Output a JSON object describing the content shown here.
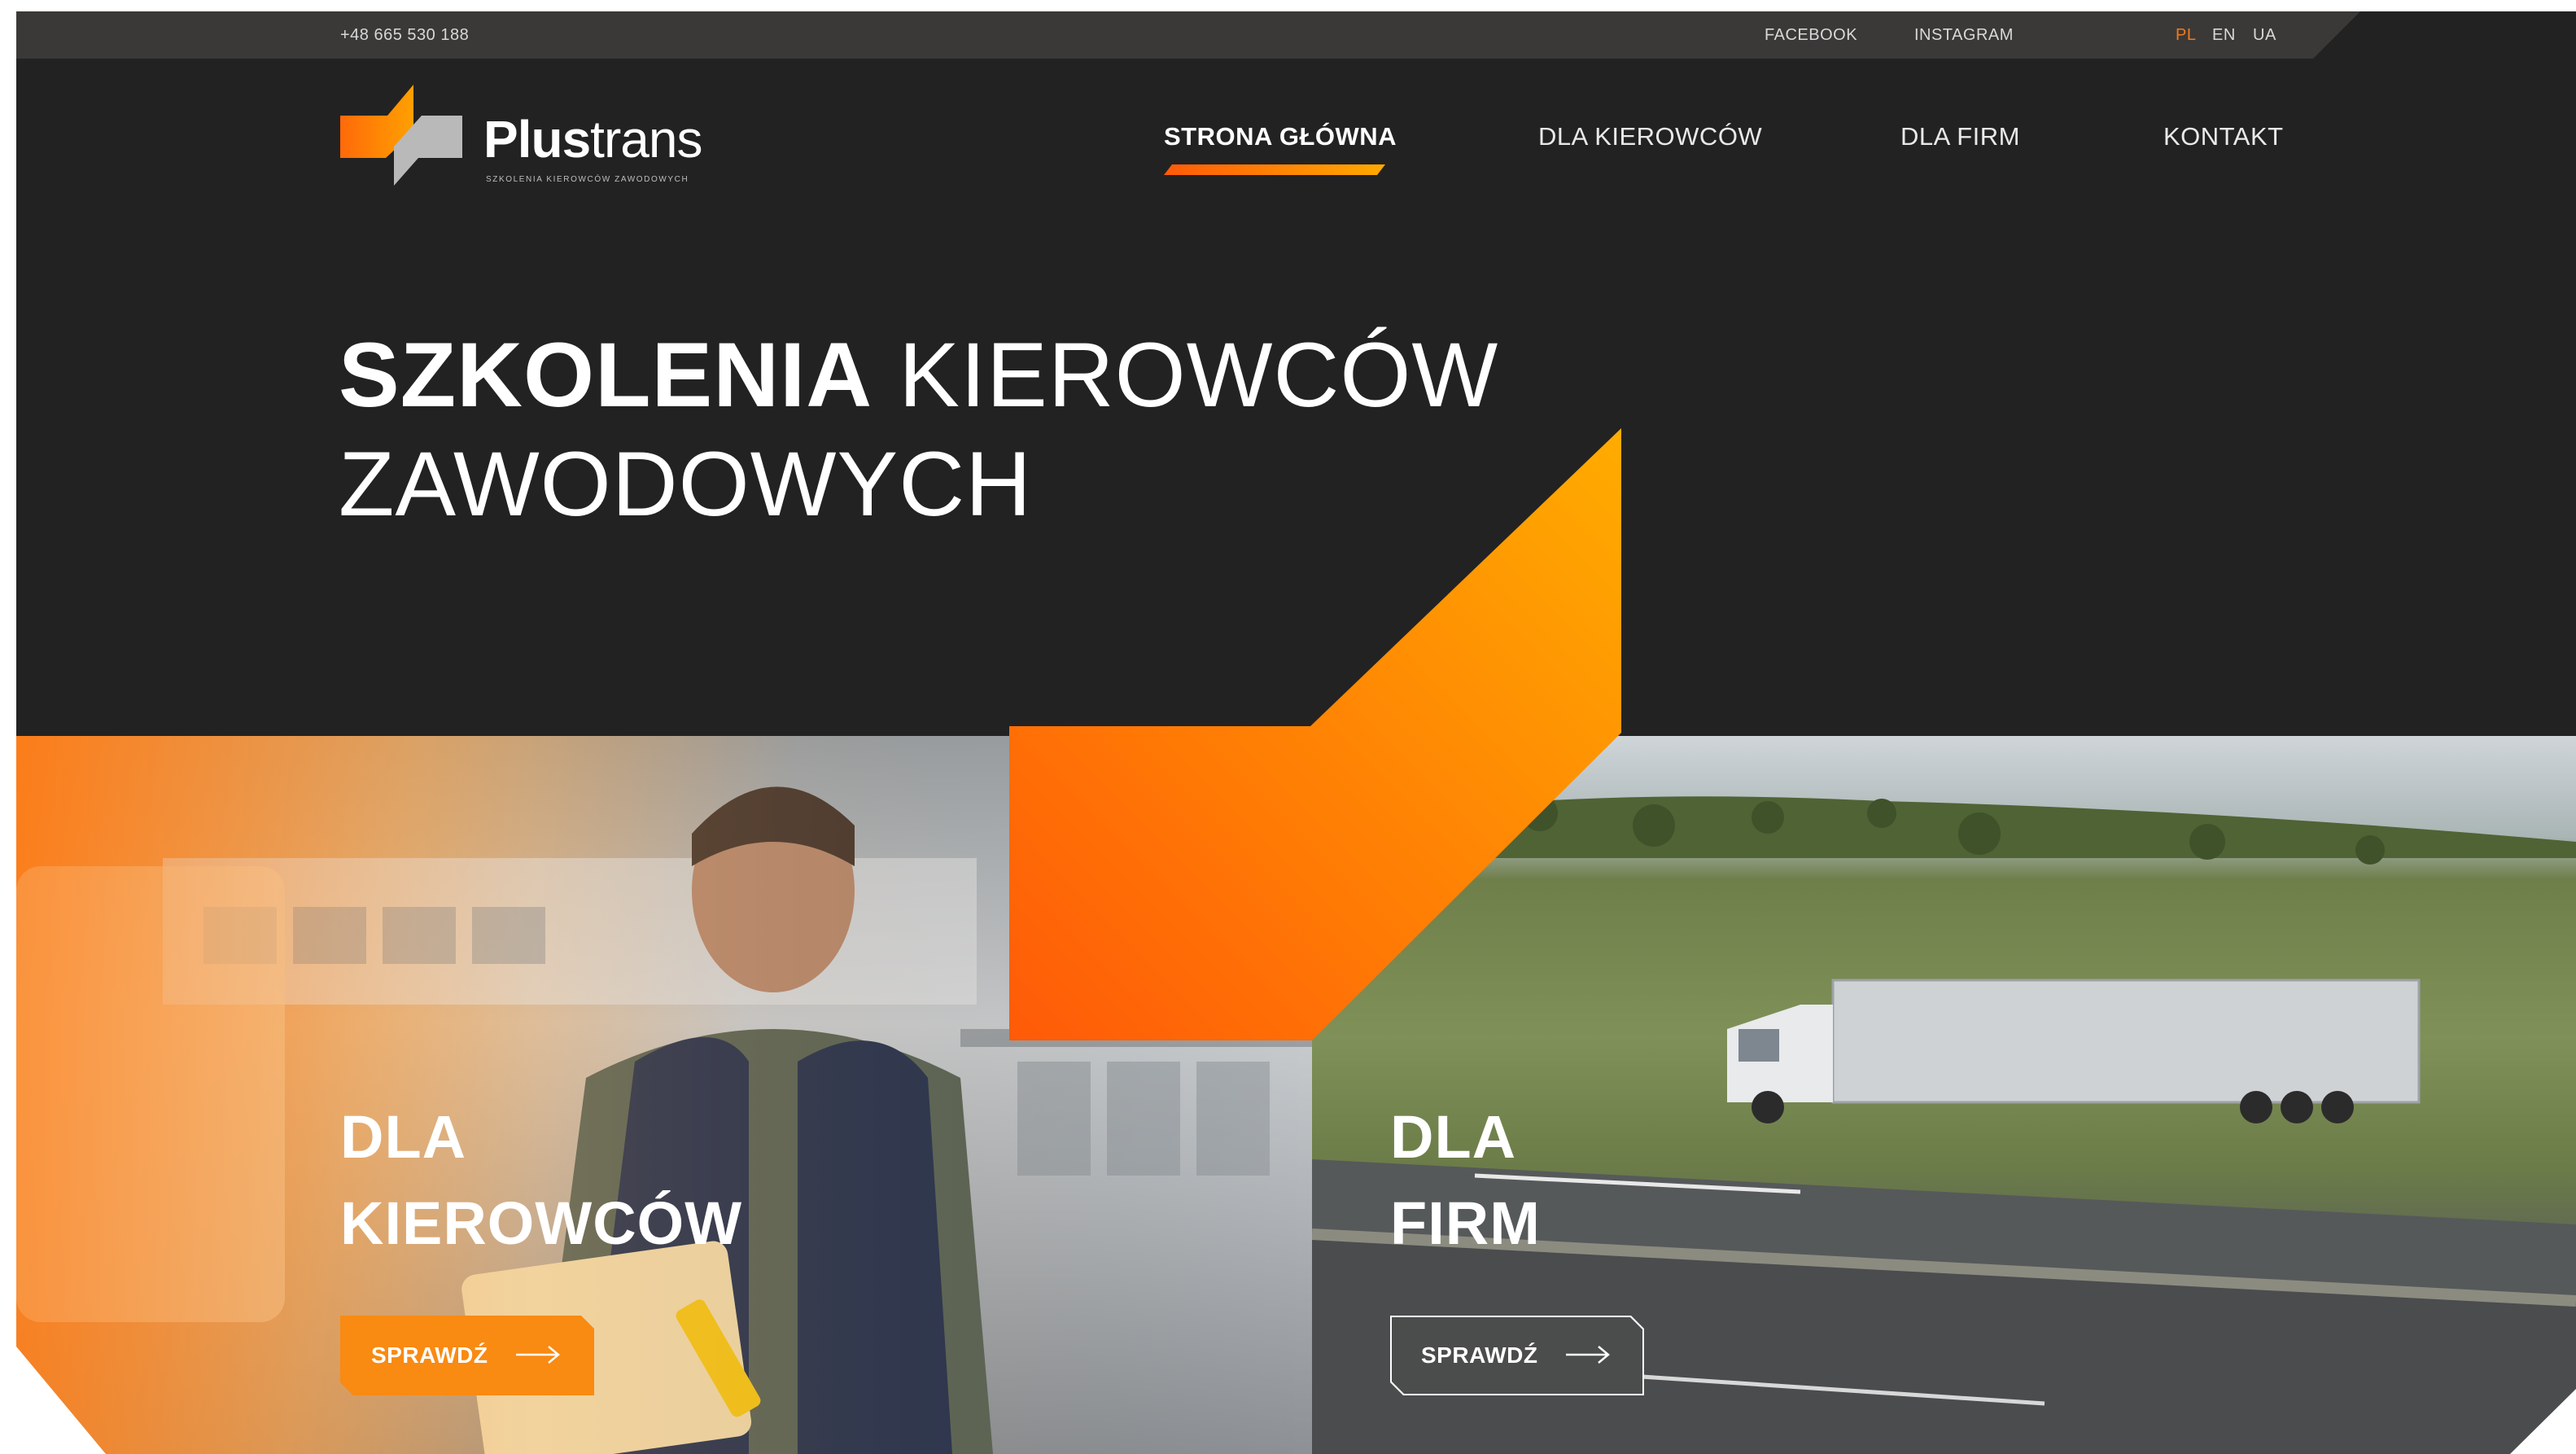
{
  "topbar": {
    "phone": "+48 665 530 188",
    "facebook": "FACEBOOK",
    "instagram": "INSTAGRAM",
    "languages": [
      "PL",
      "EN",
      "UA"
    ],
    "active_language": "PL"
  },
  "logo": {
    "brand_bold": "Plus",
    "brand_light": "trans",
    "tagline": "SZKOLENIA KIEROWCÓW ZAWODOWYCH"
  },
  "nav": {
    "items": [
      "STRONA GŁÓWNA",
      "DLA KIEROWCÓW",
      "DLA FIRM",
      "KONTAKT"
    ],
    "active": "STRONA GŁÓWNA"
  },
  "hero": {
    "title_bold": "SZKOLENIA",
    "title_rest": "KIEROWCÓW",
    "title_line2": "ZAWODOWYCH"
  },
  "panels": [
    {
      "title_line1": "DLA",
      "title_line2": "KIEROWCÓW",
      "button": "SPRAWDŹ",
      "button_style": "solid"
    },
    {
      "title_line1": "DLA",
      "title_line2": "FIRM",
      "button": "SPRAWDŹ",
      "button_style": "outline"
    }
  ],
  "colors": {
    "background": "#232222",
    "topbar": "#3a3938",
    "accent_orange": "#f98a12",
    "accent_gradient_start": "#ff5a08",
    "accent_gradient_end": "#ffaa00"
  }
}
